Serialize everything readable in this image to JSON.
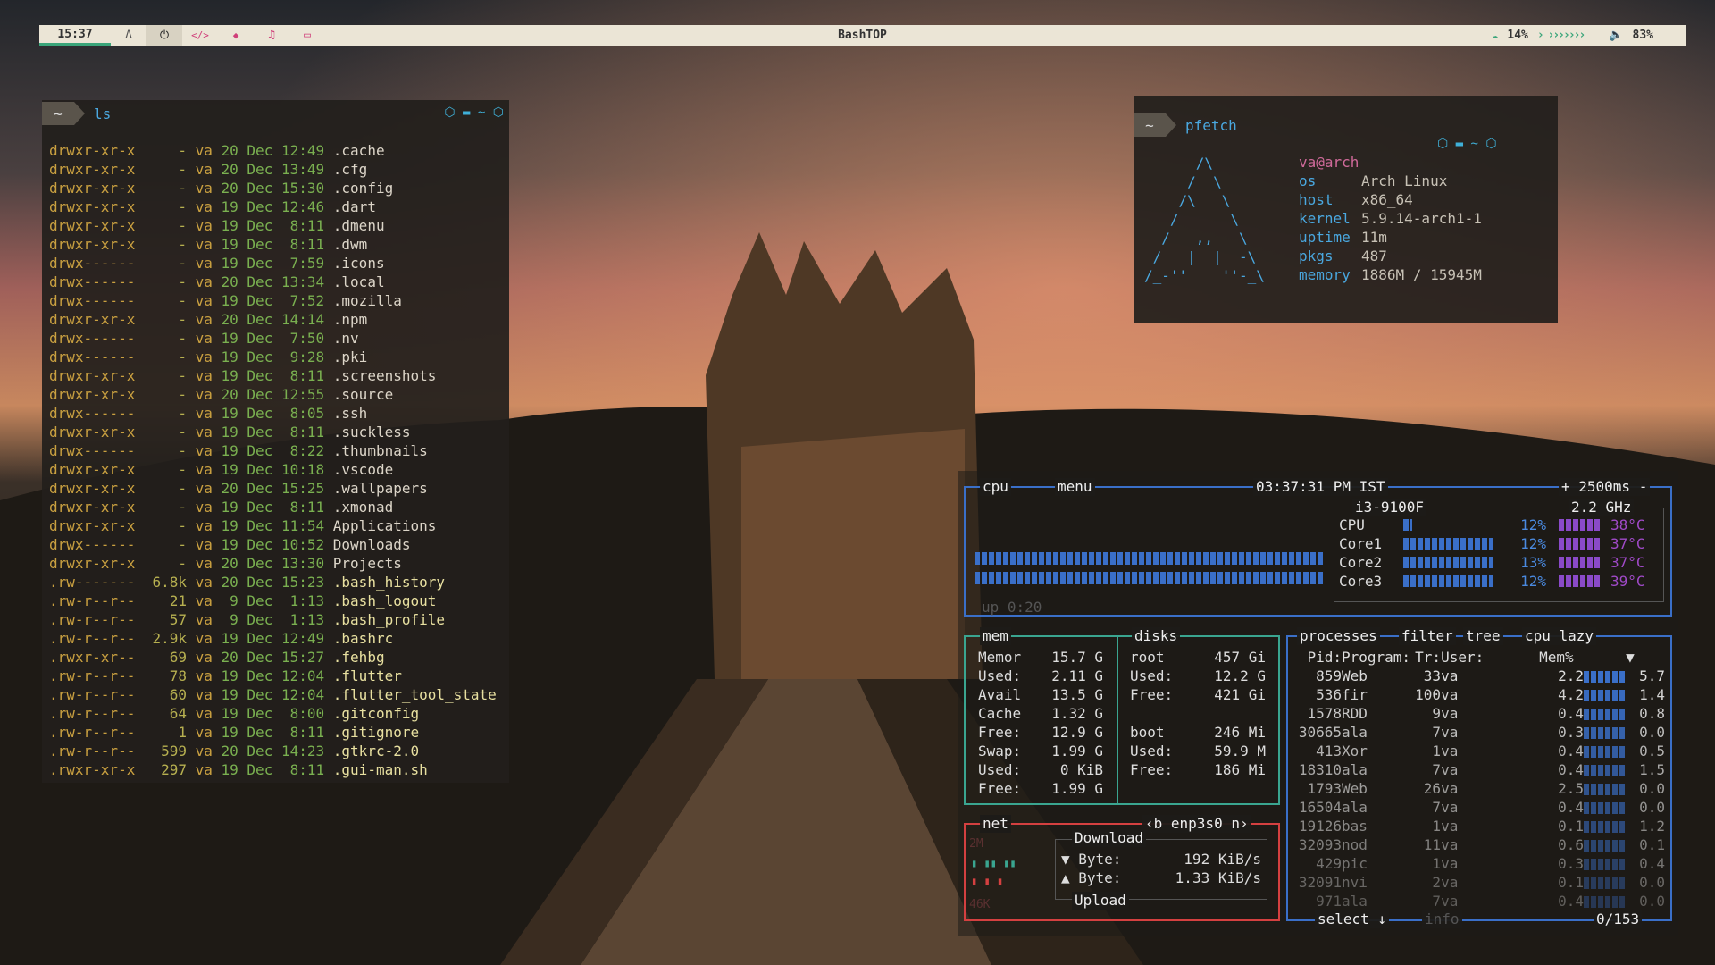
{
  "colors": {
    "sky_dark": "#2b2d31",
    "sky_glow": "#d9826a",
    "forest": "#1e1a15",
    "castle": "#6b4a30",
    "bar_bg": "#ebe5d6",
    "accent_blue": "#4aa8e0",
    "cpu_box": "#3a6fc8",
    "mem_box": "#3aa590",
    "net_box": "#d44040"
  },
  "bar": {
    "clock": "15:37",
    "workspaces": [
      {
        "icon": "arch-icon",
        "glyph": "Λ"
      },
      {
        "icon": "power-icon",
        "glyph": "⏻"
      },
      {
        "icon": "code-icon",
        "glyph": "</>"
      },
      {
        "icon": "diamond-icon",
        "glyph": "◆"
      },
      {
        "icon": "headphones-icon",
        "glyph": "♫"
      },
      {
        "icon": "calendar-icon",
        "glyph": "▭"
      }
    ],
    "title": "BashTOP",
    "cpu_value": "14%",
    "chevrons": "› ›››››››",
    "volume": "83%"
  },
  "ls": {
    "tilde": "~",
    "command": "ls",
    "icons": "⬡ ▬ ~ ⬡",
    "rows": [
      {
        "perm": "drwxr-xr-x",
        "size": "-",
        "user": "va",
        "day": "20",
        "mon": "Dec",
        "time": "12:49",
        "name": ".cache"
      },
      {
        "perm": "drwxr-xr-x",
        "size": "-",
        "user": "va",
        "day": "20",
        "mon": "Dec",
        "time": "13:49",
        "name": ".cfg"
      },
      {
        "perm": "drwxr-xr-x",
        "size": "-",
        "user": "va",
        "day": "20",
        "mon": "Dec",
        "time": "15:30",
        "name": ".config"
      },
      {
        "perm": "drwxr-xr-x",
        "size": "-",
        "user": "va",
        "day": "19",
        "mon": "Dec",
        "time": "12:46",
        "name": ".dart"
      },
      {
        "perm": "drwxr-xr-x",
        "size": "-",
        "user": "va",
        "day": "19",
        "mon": "Dec",
        "time": " 8:11",
        "name": ".dmenu"
      },
      {
        "perm": "drwxr-xr-x",
        "size": "-",
        "user": "va",
        "day": "19",
        "mon": "Dec",
        "time": " 8:11",
        "name": ".dwm"
      },
      {
        "perm": "drwx------",
        "size": "-",
        "user": "va",
        "day": "19",
        "mon": "Dec",
        "time": " 7:59",
        "name": ".icons"
      },
      {
        "perm": "drwx------",
        "size": "-",
        "user": "va",
        "day": "20",
        "mon": "Dec",
        "time": "13:34",
        "name": ".local"
      },
      {
        "perm": "drwx------",
        "size": "-",
        "user": "va",
        "day": "19",
        "mon": "Dec",
        "time": " 7:52",
        "name": ".mozilla"
      },
      {
        "perm": "drwxr-xr-x",
        "size": "-",
        "user": "va",
        "day": "20",
        "mon": "Dec",
        "time": "14:14",
        "name": ".npm"
      },
      {
        "perm": "drwx------",
        "size": "-",
        "user": "va",
        "day": "19",
        "mon": "Dec",
        "time": " 7:50",
        "name": ".nv"
      },
      {
        "perm": "drwx------",
        "size": "-",
        "user": "va",
        "day": "19",
        "mon": "Dec",
        "time": " 9:28",
        "name": ".pki"
      },
      {
        "perm": "drwxr-xr-x",
        "size": "-",
        "user": "va",
        "day": "19",
        "mon": "Dec",
        "time": " 8:11",
        "name": ".screenshots"
      },
      {
        "perm": "drwxr-xr-x",
        "size": "-",
        "user": "va",
        "day": "20",
        "mon": "Dec",
        "time": "12:55",
        "name": ".source"
      },
      {
        "perm": "drwx------",
        "size": "-",
        "user": "va",
        "day": "19",
        "mon": "Dec",
        "time": " 8:05",
        "name": ".ssh"
      },
      {
        "perm": "drwxr-xr-x",
        "size": "-",
        "user": "va",
        "day": "19",
        "mon": "Dec",
        "time": " 8:11",
        "name": ".suckless"
      },
      {
        "perm": "drwx------",
        "size": "-",
        "user": "va",
        "day": "19",
        "mon": "Dec",
        "time": " 8:22",
        "name": ".thumbnails"
      },
      {
        "perm": "drwxr-xr-x",
        "size": "-",
        "user": "va",
        "day": "19",
        "mon": "Dec",
        "time": "10:18",
        "name": ".vscode"
      },
      {
        "perm": "drwxr-xr-x",
        "size": "-",
        "user": "va",
        "day": "20",
        "mon": "Dec",
        "time": "15:25",
        "name": ".wallpapers"
      },
      {
        "perm": "drwxr-xr-x",
        "size": "-",
        "user": "va",
        "day": "19",
        "mon": "Dec",
        "time": " 8:11",
        "name": ".xmonad"
      },
      {
        "perm": "drwxr-xr-x",
        "size": "-",
        "user": "va",
        "day": "19",
        "mon": "Dec",
        "time": "11:54",
        "name": "Applications"
      },
      {
        "perm": "drwx------",
        "size": "-",
        "user": "va",
        "day": "19",
        "mon": "Dec",
        "time": "10:52",
        "name": "Downloads"
      },
      {
        "perm": "drwxr-xr-x",
        "size": "-",
        "user": "va",
        "day": "20",
        "mon": "Dec",
        "time": "13:30",
        "name": "Projects"
      },
      {
        "perm": ".rw-------",
        "size": "6.8k",
        "user": "va",
        "day": "20",
        "mon": "Dec",
        "time": "15:23",
        "name": ".bash_history"
      },
      {
        "perm": ".rw-r--r--",
        "size": "21",
        "user": "va",
        "day": " 9",
        "mon": "Dec",
        "time": " 1:13",
        "name": ".bash_logout"
      },
      {
        "perm": ".rw-r--r--",
        "size": "57",
        "user": "va",
        "day": " 9",
        "mon": "Dec",
        "time": " 1:13",
        "name": ".bash_profile"
      },
      {
        "perm": ".rw-r--r--",
        "size": "2.9k",
        "user": "va",
        "day": "19",
        "mon": "Dec",
        "time": "12:49",
        "name": ".bashrc"
      },
      {
        "perm": ".rwxr-xr--",
        "size": "69",
        "user": "va",
        "day": "20",
        "mon": "Dec",
        "time": "15:27",
        "name": ".fehbg"
      },
      {
        "perm": ".rw-r--r--",
        "size": "78",
        "user": "va",
        "day": "19",
        "mon": "Dec",
        "time": "12:04",
        "name": ".flutter"
      },
      {
        "perm": ".rw-r--r--",
        "size": "60",
        "user": "va",
        "day": "19",
        "mon": "Dec",
        "time": "12:04",
        "name": ".flutter_tool_state"
      },
      {
        "perm": ".rw-r--r--",
        "size": "64",
        "user": "va",
        "day": "19",
        "mon": "Dec",
        "time": " 8:00",
        "name": ".gitconfig"
      },
      {
        "perm": ".rw-r--r--",
        "size": "1",
        "user": "va",
        "day": "19",
        "mon": "Dec",
        "time": " 8:11",
        "name": ".gitignore"
      },
      {
        "perm": ".rw-r--r--",
        "size": "599",
        "user": "va",
        "day": "20",
        "mon": "Dec",
        "time": "14:23",
        "name": ".gtkrc-2.0"
      },
      {
        "perm": ".rwxr-xr-x",
        "size": "297",
        "user": "va",
        "day": "19",
        "mon": "Dec",
        "time": " 8:11",
        "name": ".gui-man.sh"
      }
    ]
  },
  "pfetch": {
    "tilde": "~",
    "command": "pfetch",
    "icons": "⬡ ▬ ~ ⬡",
    "logo": "      /\\\n     /  \\\n    /\\   \\\n   /      \\\n  /   ,,   \\\n /   |  |  -\\\n/_-''    ''-_\\",
    "userhost": "va@arch",
    "info": [
      {
        "k": "os",
        "v": "Arch Linux"
      },
      {
        "k": "host",
        "v": "x86_64"
      },
      {
        "k": "kernel",
        "v": "5.9.14-arch1-1"
      },
      {
        "k": "uptime",
        "v": "11m"
      },
      {
        "k": "pkgs",
        "v": "487"
      },
      {
        "k": "memory",
        "v": "1886M / 15945M"
      }
    ]
  },
  "btop": {
    "cpu_tab": "cpu",
    "menu_tab": "menu",
    "time": "03:37:31 PM IST",
    "refresh": "+ 2500ms -",
    "model": "i3-9100F",
    "freq": "2.2 GHz",
    "uptime": "up 0:20",
    "cores": [
      {
        "name": "CPU",
        "pct": "12%",
        "temp": "38°C",
        "load": 0.12
      },
      {
        "name": "Core1",
        "pct": "12%",
        "temp": "37°C",
        "load": 0.12
      },
      {
        "name": "Core2",
        "pct": "13%",
        "temp": "37°C",
        "load": 0.13
      },
      {
        "name": "Core3",
        "pct": "12%",
        "temp": "39°C",
        "load": 0.12
      }
    ],
    "mem": {
      "title": "mem",
      "rows": [
        [
          "Memor",
          "15.7 G"
        ],
        [
          "Used:",
          "2.11 G"
        ],
        [
          "Avail",
          "13.5 G"
        ],
        [
          "Cache",
          "1.32 G"
        ],
        [
          "Free:",
          "12.9 G"
        ],
        [
          "Swap:",
          "1.99 G"
        ],
        [
          "Used:",
          "0 KiB"
        ],
        [
          "Free:",
          "1.99 G"
        ]
      ]
    },
    "disks": {
      "title": "disks",
      "rows": [
        [
          "root",
          "457 Gi"
        ],
        [
          "Used:",
          "12.2 G"
        ],
        [
          "Free:",
          "421 Gi"
        ],
        [
          "",
          ""
        ],
        [
          "boot",
          "246 Mi"
        ],
        [
          "Used:",
          "59.9 M"
        ],
        [
          "Free:",
          "186 Mi"
        ]
      ]
    },
    "proc": {
      "tabs": [
        "processes",
        "filter",
        "tree",
        "cpu lazy"
      ],
      "headers": [
        "Pid:",
        "Program:",
        "Tr:",
        "User:",
        "Mem%"
      ],
      "sort_arrow": "▼",
      "rows": [
        [
          "859",
          "Web",
          "33",
          "va",
          "2.2",
          "5.7"
        ],
        [
          "536",
          "fir",
          "100",
          "va",
          "4.2",
          "1.4"
        ],
        [
          "1578",
          "RDD",
          "9",
          "va",
          "0.4",
          "0.8"
        ],
        [
          "30665",
          "ala",
          "7",
          "va",
          "0.3",
          "0.0"
        ],
        [
          "413",
          "Xor",
          "1",
          "va",
          "0.4",
          "0.5"
        ],
        [
          "18310",
          "ala",
          "7",
          "va",
          "0.4",
          "1.5"
        ],
        [
          "1793",
          "Web",
          "26",
          "va",
          "2.5",
          "0.0"
        ],
        [
          "16504",
          "ala",
          "7",
          "va",
          "0.4",
          "0.0"
        ],
        [
          "19126",
          "bas",
          "1",
          "va",
          "0.1",
          "1.2"
        ],
        [
          "32093",
          "nod",
          "11",
          "va",
          "0.6",
          "0.1"
        ],
        [
          "429",
          "pic",
          "1",
          "va",
          "0.3",
          "0.4"
        ],
        [
          "32091",
          "nvi",
          "2",
          "va",
          "0.1",
          "0.0"
        ],
        [
          "971",
          "ala",
          "7",
          "va",
          "0.4",
          "0.0"
        ]
      ],
      "select": "select ↓",
      "info": "info",
      "count": "0/153"
    },
    "net": {
      "title": "net",
      "iface": "‹b enp3s0 n›",
      "scale_top": "2M",
      "scale_bottom": "46K",
      "download": "Download",
      "down_label": "▼ Byte:",
      "down_val": "192 KiB/s",
      "up_label": "▲ Byte:",
      "up_val": "1.33 KiB/s",
      "upload": "Upload"
    }
  }
}
